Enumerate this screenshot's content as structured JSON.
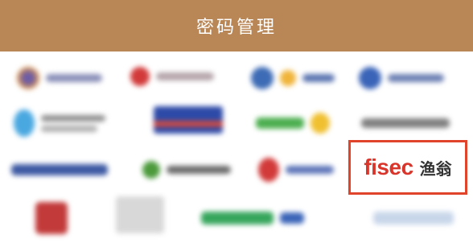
{
  "header": {
    "title": "密码管理",
    "background": "#b98656"
  },
  "highlight": {
    "logo_text": "fisec",
    "logo_cn": "渔翁",
    "logo_color": "#d9352a",
    "border_color": "#e0452c"
  },
  "blurred_logos": [
    "logo-1",
    "logo-2",
    "logo-3",
    "logo-4",
    "logo-5",
    "logo-6",
    "logo-7",
    "logo-8",
    "logo-9",
    "logo-10",
    "logo-11",
    "logo-12",
    "logo-13",
    "logo-14",
    "logo-15"
  ]
}
